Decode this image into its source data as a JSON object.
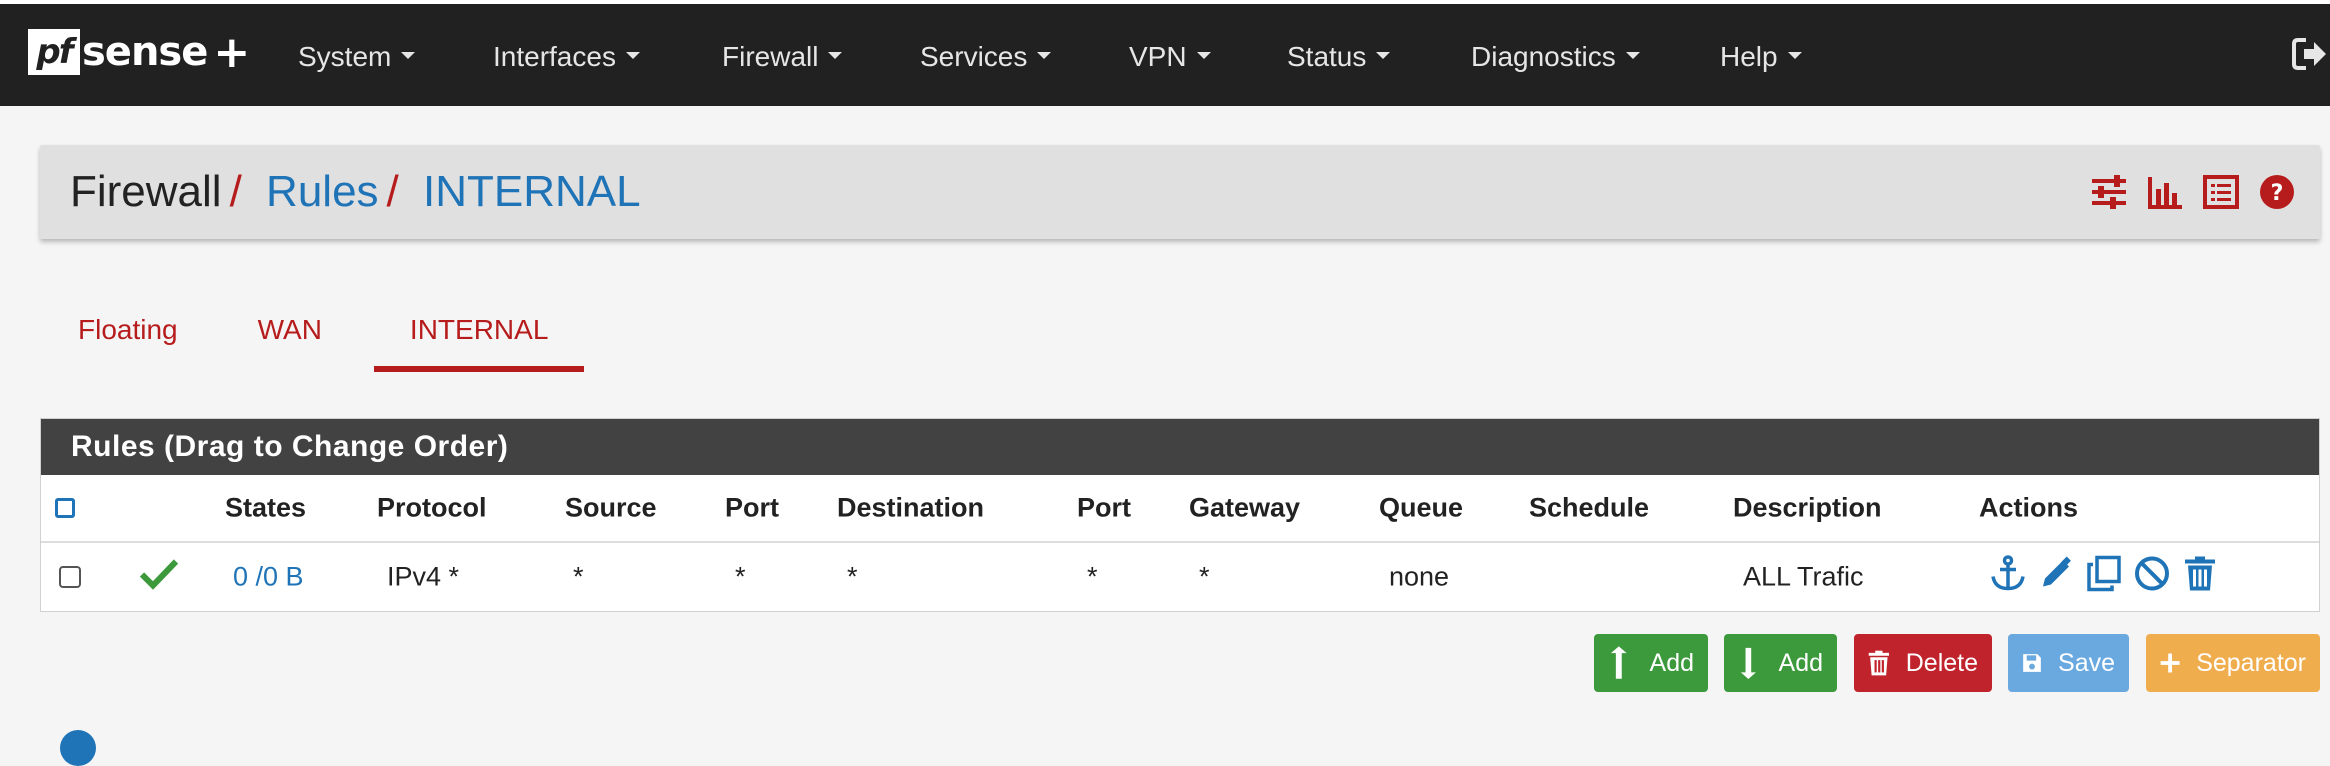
{
  "brand": {
    "logo_mark": "pf",
    "logo_text": "sense",
    "logo_plus": "+"
  },
  "nav": [
    {
      "label": "System",
      "left": 0
    },
    {
      "label": "Interfaces"
    },
    {
      "label": "Firewall"
    },
    {
      "label": "Services"
    },
    {
      "label": "VPN"
    },
    {
      "label": "Status"
    },
    {
      "label": "Diagnostics"
    },
    {
      "label": "Help"
    }
  ],
  "breadcrumb": {
    "part1": "Firewall",
    "sep1": "/",
    "part2": "Rules",
    "sep2": "/",
    "part3": "INTERNAL"
  },
  "tabs": [
    "Floating",
    "WAN",
    "INTERNAL"
  ],
  "rules": {
    "title": "Rules (Drag to Change Order)",
    "headers": [
      "States",
      "Protocol",
      "Source",
      "Port",
      "Destination",
      "Port",
      "Gateway",
      "Queue",
      "Schedule",
      "Description",
      "Actions"
    ],
    "rows": [
      {
        "states": "0 /0 B",
        "protocol": "IPv4 *",
        "source": "*",
        "port": "*",
        "destination": "*",
        "dport": "*",
        "gateway": "*",
        "queue": "none",
        "schedule": "",
        "description": "ALL Trafic"
      }
    ]
  },
  "buttons": {
    "add_top": "Add",
    "add_bottom": "Add",
    "delete": "Delete",
    "save": "Save",
    "separator": "Separator"
  },
  "colors": {
    "accent_red": "#b71c1c",
    "link_blue": "#1f73b7",
    "green": "#3c9a3c",
    "save_blue": "#6aa9e0",
    "separator_orange": "#f0ad4e"
  }
}
